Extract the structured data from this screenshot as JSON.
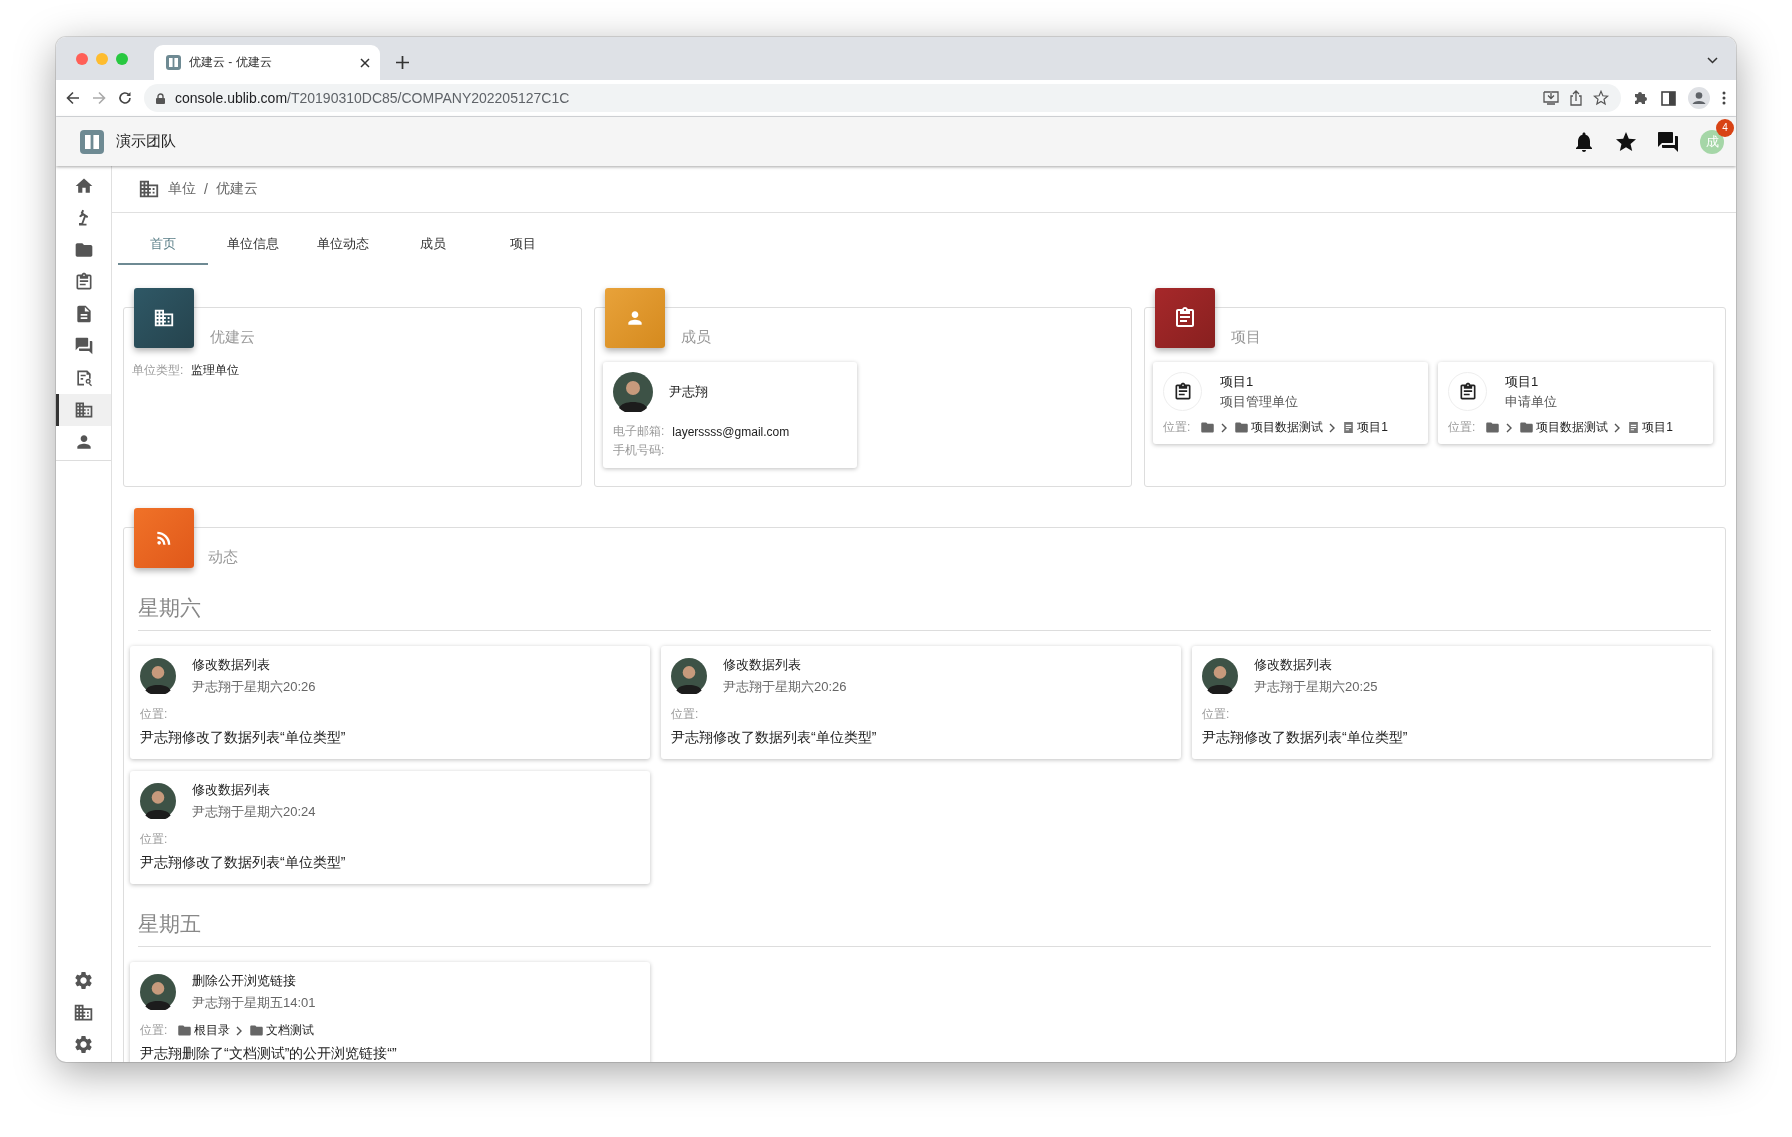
{
  "browser": {
    "tab_title": "优建云 - 优建云",
    "url_host": "console.ublib.com",
    "url_path": "/T20190310DC85/COMPANY202205127C1C"
  },
  "app_bar": {
    "team": "演示团队",
    "avatar_text": "成",
    "badge": "4"
  },
  "sidebar": {
    "items": [
      {
        "kind": "home",
        "selected": false
      },
      {
        "kind": "lamp",
        "selected": false
      },
      {
        "kind": "folder",
        "selected": false
      },
      {
        "kind": "clipboard",
        "selected": false
      },
      {
        "kind": "document",
        "selected": false
      },
      {
        "kind": "forum",
        "selected": false
      },
      {
        "kind": "find",
        "selected": false
      },
      {
        "kind": "building",
        "selected": true
      },
      {
        "kind": "person",
        "selected": false
      }
    ],
    "bottom_items": [
      {
        "kind": "gear",
        "selected": false
      },
      {
        "kind": "building",
        "selected": false
      },
      {
        "kind": "gear",
        "selected": false
      }
    ]
  },
  "breadcrumb": {
    "items": [
      "单位",
      "优建云"
    ],
    "separator": "/"
  },
  "tabs": [
    {
      "label": "首页",
      "selected": true
    },
    {
      "label": "单位信息",
      "selected": false
    },
    {
      "label": "单位动态",
      "selected": false
    },
    {
      "label": "成员",
      "selected": false
    },
    {
      "label": "项目",
      "selected": false
    }
  ],
  "unit_card": {
    "title": "优建云",
    "fields": [
      {
        "label": "单位类型:",
        "value": "监理单位"
      }
    ]
  },
  "members_card": {
    "title": "成员",
    "members": [
      {
        "name": "尹志翔",
        "fields": [
          {
            "label": "电子邮箱:",
            "value": "layerssss@gmail.com"
          },
          {
            "label": "手机号码:"
          }
        ]
      }
    ]
  },
  "projects_card": {
    "title": "项目",
    "projects": [
      {
        "name": "项目1",
        "role": "项目管理单位",
        "location_label": "位置:",
        "path": [
          {
            "kind": "root"
          },
          {
            "kind": "folder",
            "label": "项目数据测试"
          },
          {
            "kind": "project",
            "label": "项目1"
          }
        ]
      },
      {
        "name": "项目1",
        "role": "申请单位",
        "location_label": "位置:",
        "path": [
          {
            "kind": "root"
          },
          {
            "kind": "folder",
            "label": "项目数据测试"
          },
          {
            "kind": "project",
            "label": "项目1"
          }
        ]
      }
    ]
  },
  "feed": {
    "title": "动态",
    "days": [
      {
        "heading": "星期六",
        "events": [
          {
            "title": "修改数据列表",
            "meta": "尹志翔于星期六20:26",
            "location_label": "位置:",
            "description": "尹志翔修改了数据列表“单位类型”"
          },
          {
            "title": "修改数据列表",
            "meta": "尹志翔于星期六20:26",
            "location_label": "位置:",
            "description": "尹志翔修改了数据列表“单位类型”"
          },
          {
            "title": "修改数据列表",
            "meta": "尹志翔于星期六20:25",
            "location_label": "位置:",
            "description": "尹志翔修改了数据列表“单位类型”"
          },
          {
            "title": "修改数据列表",
            "meta": "尹志翔于星期六20:24",
            "location_label": "位置:",
            "description": "尹志翔修改了数据列表“单位类型”"
          }
        ]
      },
      {
        "heading": "星期五",
        "events": [
          {
            "title": "删除公开浏览链接",
            "meta": "尹志翔于星期五14:01",
            "location_label": "位置:",
            "path": [
              {
                "kind": "folder",
                "label": "根目录"
              },
              {
                "kind": "folder",
                "label": "文档测试"
              }
            ],
            "description": "尹志翔删除了“文档测试”的公开浏览链接“”"
          }
        ]
      }
    ]
  }
}
